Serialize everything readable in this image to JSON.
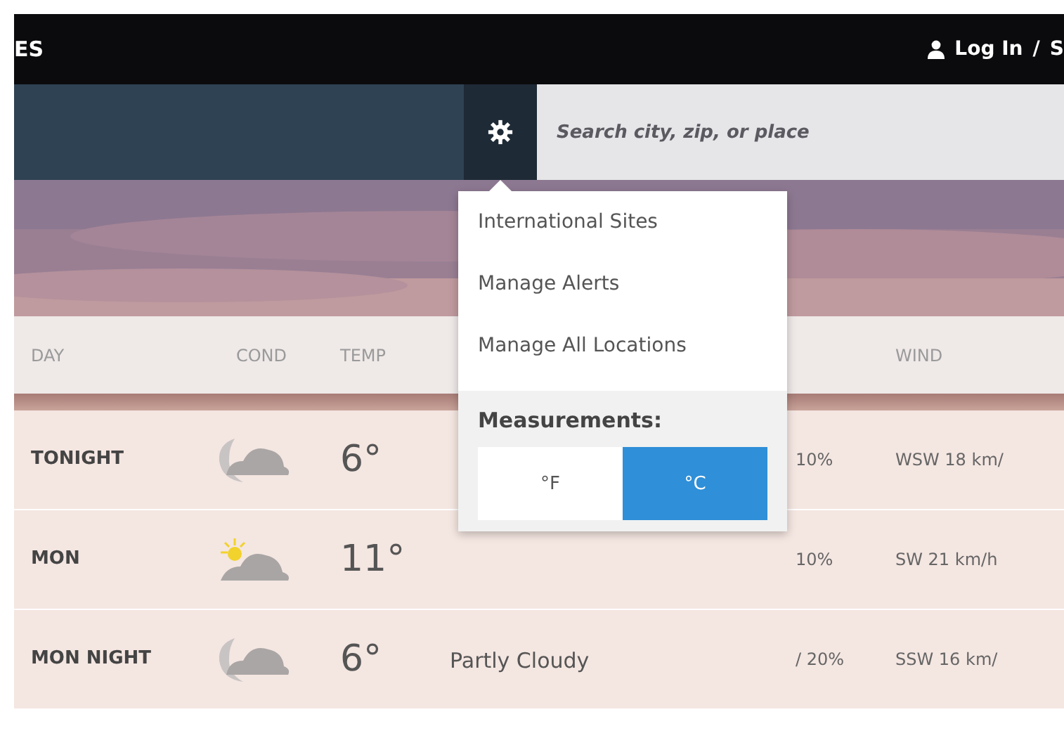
{
  "header": {
    "brand": "ES",
    "login": "Log In",
    "separator": "/",
    "signup": "S"
  },
  "search": {
    "placeholder": "Search city, zip, or place"
  },
  "menu": {
    "items": [
      "International Sites",
      "Manage Alerts",
      "Manage All Locations"
    ],
    "measurements_label": "Measurements:",
    "units": [
      {
        "label": "°F",
        "selected": false
      },
      {
        "label": "°C",
        "selected": true
      }
    ]
  },
  "table": {
    "columns": [
      "DAY",
      "COND",
      "TEMP",
      "WIND"
    ],
    "rows": [
      {
        "day": "TONIGHT",
        "kind": "night",
        "temp": "6°",
        "precip": "10%",
        "wind": "WSW 18 km/"
      },
      {
        "day": "MON",
        "kind": "day",
        "temp": "11°",
        "precip": "10%",
        "wind": "SW 21 km/h"
      },
      {
        "day": "MON NIGHT",
        "kind": "night",
        "temp": "6°",
        "condition": "Partly Cloudy",
        "precip": "/ 20%",
        "wind": "SSW 16 km/"
      }
    ]
  }
}
